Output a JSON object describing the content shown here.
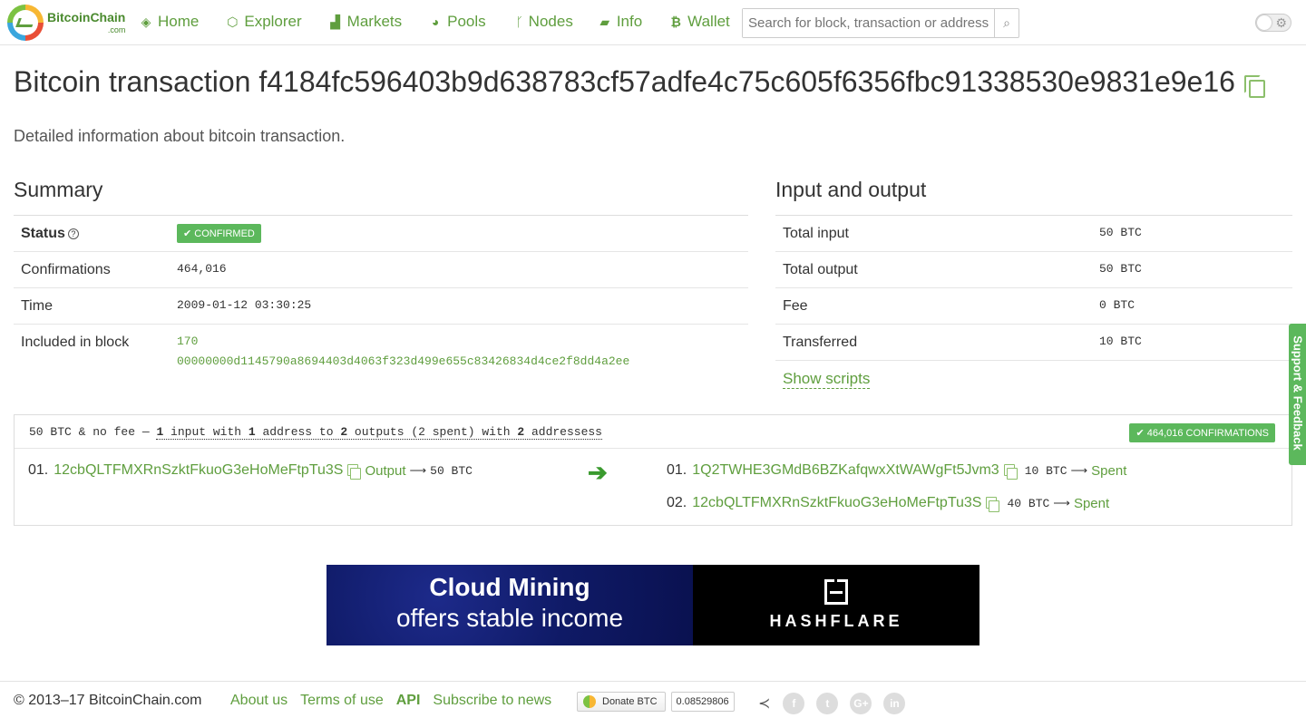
{
  "brand": {
    "name": "BitcoinChain",
    "domain": ".com"
  },
  "nav": [
    {
      "icon": "cube-icon",
      "label": "Home"
    },
    {
      "icon": "explorer-icon",
      "label": "Explorer"
    },
    {
      "icon": "chart-icon",
      "label": "Markets"
    },
    {
      "icon": "pie-icon",
      "label": "Pools"
    },
    {
      "icon": "branch-icon",
      "label": "Nodes"
    },
    {
      "icon": "book-icon",
      "label": "Info"
    },
    {
      "icon": "bitcoin-icon",
      "label": "Wallet"
    }
  ],
  "search": {
    "placeholder": "Search for block, transaction or address"
  },
  "page": {
    "title": "Bitcoin transaction f4184fc596403b9d638783cf57adfe4c75c605f6356fbc91338530e9831e9e16",
    "subtitle": "Detailed information about bitcoin transaction."
  },
  "summary": {
    "heading": "Summary",
    "status_label": "Status",
    "status_value": "✔ CONFIRMED",
    "confirmations_label": "Confirmations",
    "confirmations_value": "464,016",
    "time_label": "Time",
    "time_value": "2009-01-12 03:30:25",
    "block_label": "Included in block",
    "block_height": "170",
    "block_hash": "00000000d1145790a8694403d4063f323d499e655c83426834d4ce2f8dd4a2ee"
  },
  "io": {
    "heading": "Input and output",
    "rows": [
      {
        "label": "Total input",
        "value": "50 BTC"
      },
      {
        "label": "Total output",
        "value": "50 BTC"
      },
      {
        "label": "Fee",
        "value": "0 BTC"
      },
      {
        "label": "Transferred",
        "value": "10 BTC"
      }
    ],
    "show_scripts": "Show scripts"
  },
  "tx": {
    "summary_prefix": "50 BTC & no fee — ",
    "inputs_count": "1",
    "inputs_text": " input with ",
    "input_addr_count": "1",
    "addr_text": " address to ",
    "outputs_count": "2",
    "outputs_text": " outputs (2 spent) with ",
    "output_addr_count": "2",
    "addr_text2": " addressess",
    "confirmations_badge": "✔ 464,016 CONFIRMATIONS",
    "inputs": [
      {
        "num": "01.",
        "address": "12cbQLTFMXRnSzktFkuoG3eHoMeFtpTu3S",
        "link": "Output",
        "arrow": "⟶",
        "value": "50 BTC"
      }
    ],
    "outputs": [
      {
        "num": "01.",
        "address": "1Q2TWHE3GMdB6BZKafqwxXtWAWgFt5Jvm3",
        "value": "10 BTC",
        "arrow": "⟶",
        "state": "Spent"
      },
      {
        "num": "02.",
        "address": "12cbQLTFMXRnSzktFkuoG3eHoMeFtpTu3S",
        "value": "40 BTC",
        "arrow": "⟶",
        "state": "Spent"
      }
    ]
  },
  "banner": {
    "line1": "Cloud Mining",
    "line2": "offers stable income",
    "brand": "HASHFLARE"
  },
  "footer": {
    "copyright": "© 2013–17 BitcoinChain.com",
    "links": [
      "About us",
      "Terms of use",
      "API",
      "Subscribe to news"
    ],
    "donate_label": "Donate BTC",
    "donate_amount": "0.08529806"
  },
  "feedback": "Support & Feedback",
  "colors": {
    "accent": "#5f9e3e",
    "badge": "#5cb85c"
  }
}
